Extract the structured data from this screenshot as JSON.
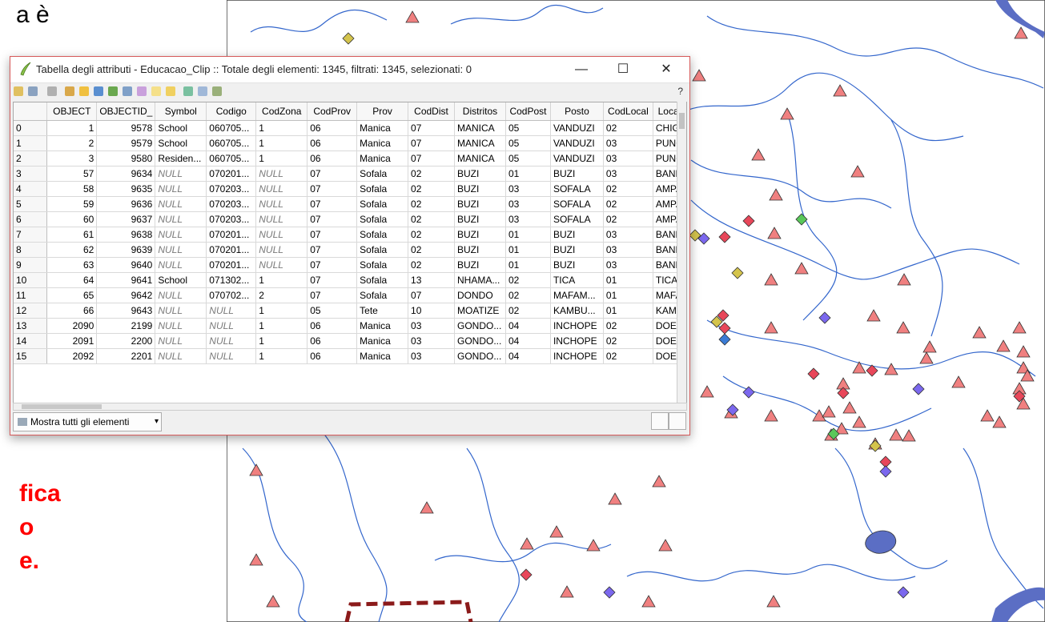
{
  "slide": {
    "top_text": "a è",
    "red_lines": [
      "fica",
      "o",
      "e."
    ]
  },
  "window": {
    "title": "Tabella degli attributi - Educacao_Clip :: Totale degli elementi: 1345, filtrati: 1345, selezionati: 0",
    "minimize_label": "—",
    "maximize_label": "☐",
    "close_label": "✕",
    "help_label": "?",
    "show_all_label": "Mostra tutti gli elementi"
  },
  "table": {
    "headers": [
      "OBJECT",
      "OBJECTID_",
      "Symbol",
      "Codigo",
      "CodZona",
      "CodProv",
      "Prov",
      "CodDist",
      "Distritos",
      "CodPost",
      "Posto",
      "CodLocal",
      "Local"
    ],
    "rows": [
      [
        "0",
        "1",
        "9578",
        "School",
        "060705...",
        "1",
        "06",
        "Manica",
        "07",
        "MANICA",
        "05",
        "VANDUZI",
        "02",
        "CHIG"
      ],
      [
        "1",
        "2",
        "9579",
        "School",
        "060705...",
        "1",
        "06",
        "Manica",
        "07",
        "MANICA",
        "05",
        "VANDUZI",
        "03",
        "PUNC"
      ],
      [
        "2",
        "3",
        "9580",
        "Residen...",
        "060705...",
        "1",
        "06",
        "Manica",
        "07",
        "MANICA",
        "05",
        "VANDUZI",
        "03",
        "PUNC"
      ],
      [
        "3",
        "57",
        "9634",
        "NULL",
        "070201...",
        "NULL",
        "07",
        "Sofala",
        "02",
        "BUZI",
        "01",
        "BUZI",
        "03",
        "BANL"
      ],
      [
        "4",
        "58",
        "9635",
        "NULL",
        "070203...",
        "NULL",
        "07",
        "Sofala",
        "02",
        "BUZI",
        "03",
        "SOFALA",
        "02",
        "AMPA"
      ],
      [
        "5",
        "59",
        "9636",
        "NULL",
        "070203...",
        "NULL",
        "07",
        "Sofala",
        "02",
        "BUZI",
        "03",
        "SOFALA",
        "02",
        "AMPA"
      ],
      [
        "6",
        "60",
        "9637",
        "NULL",
        "070203...",
        "NULL",
        "07",
        "Sofala",
        "02",
        "BUZI",
        "03",
        "SOFALA",
        "02",
        "AMPA"
      ],
      [
        "7",
        "61",
        "9638",
        "NULL",
        "070201...",
        "NULL",
        "07",
        "Sofala",
        "02",
        "BUZI",
        "01",
        "BUZI",
        "03",
        "BANL"
      ],
      [
        "8",
        "62",
        "9639",
        "NULL",
        "070201...",
        "NULL",
        "07",
        "Sofala",
        "02",
        "BUZI",
        "01",
        "BUZI",
        "03",
        "BANL"
      ],
      [
        "9",
        "63",
        "9640",
        "NULL",
        "070201...",
        "NULL",
        "07",
        "Sofala",
        "02",
        "BUZI",
        "01",
        "BUZI",
        "03",
        "BANL"
      ],
      [
        "10",
        "64",
        "9641",
        "School",
        "071302...",
        "1",
        "07",
        "Sofala",
        "13",
        "NHAMA...",
        "02",
        "TICA",
        "01",
        "TICA"
      ],
      [
        "11",
        "65",
        "9642",
        "NULL",
        "070702...",
        "2",
        "07",
        "Sofala",
        "07",
        "DONDO",
        "02",
        "MAFAM...",
        "01",
        "MAFA"
      ],
      [
        "12",
        "66",
        "9643",
        "NULL",
        "NULL",
        "1",
        "05",
        "Tete",
        "10",
        "MOATIZE",
        "02",
        "KAMBU...",
        "01",
        "KAME"
      ],
      [
        "13",
        "2090",
        "2199",
        "NULL",
        "NULL",
        "1",
        "06",
        "Manica",
        "03",
        "GONDO...",
        "04",
        "INCHOPE",
        "02",
        "DOEF"
      ],
      [
        "14",
        "2091",
        "2200",
        "NULL",
        "NULL",
        "1",
        "06",
        "Manica",
        "03",
        "GONDO...",
        "04",
        "INCHOPE",
        "02",
        "DOEF"
      ],
      [
        "15",
        "2092",
        "2201",
        "NULL",
        "NULL",
        "1",
        "06",
        "Manica",
        "03",
        "GONDO...",
        "04",
        "INCHOPE",
        "02",
        "DOEF"
      ]
    ]
  },
  "colors": {
    "triangle_fill": "#f08080",
    "diamond_red": "#e8475a",
    "diamond_purple": "#7b68ee",
    "diamond_yellow": "#d4c44c",
    "diamond_green": "#5ac85a",
    "diamond_blue": "#3a7bd5",
    "river": "#3366cc",
    "lake": "#5b6ec4",
    "boundary": "#8b1a1a"
  }
}
